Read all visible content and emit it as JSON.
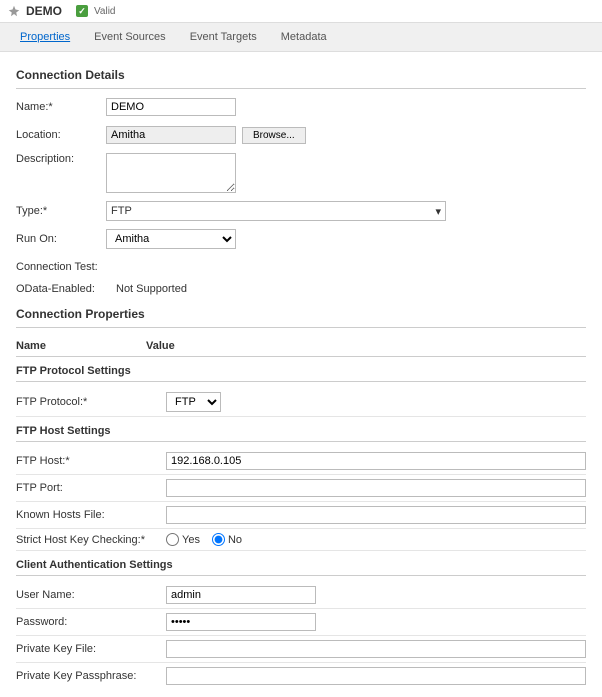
{
  "header": {
    "title": "DEMO",
    "status": "Valid"
  },
  "tabs": {
    "properties": "Properties",
    "eventSources": "Event Sources",
    "eventTargets": "Event Targets",
    "metadata": "Metadata"
  },
  "sections": {
    "connectionDetails": "Connection Details",
    "connectionProperties": "Connection Properties"
  },
  "details": {
    "nameLabel": "Name:",
    "nameValue": "DEMO",
    "locationLabel": "Location:",
    "locationValue": "Amitha",
    "browseLabel": "Browse...",
    "descriptionLabel": "Description:",
    "descriptionValue": "",
    "typeLabel": "Type:",
    "typeValue": "FTP",
    "runOnLabel": "Run On:",
    "runOnValue": "Amitha",
    "connectionTestLabel": "Connection Test:",
    "connectionTestValue": "",
    "odataLabel": "OData-Enabled:",
    "odataValue": "Not Supported"
  },
  "propHeader": {
    "name": "Name",
    "value": "Value"
  },
  "subsections": {
    "ftpProtocol": "FTP Protocol Settings",
    "ftpHost": "FTP Host Settings",
    "clientAuth": "Client Authentication Settings"
  },
  "props": {
    "ftpProtocolLabel": "FTP Protocol:",
    "ftpProtocolValue": "FTP",
    "ftpHostLabel": "FTP Host:",
    "ftpHostValue": "192.168.0.105",
    "ftpPortLabel": "FTP Port:",
    "ftpPortValue": "",
    "knownHostsLabel": "Known Hosts File:",
    "knownHostsValue": "",
    "strictLabel": "Strict Host Key Checking:",
    "yesLabel": "Yes",
    "noLabel": "No",
    "userNameLabel": "User Name:",
    "userNameValue": "admin",
    "passwordLabel": "Password:",
    "passwordValue": "•••••",
    "privateKeyLabel": "Private Key File:",
    "privateKeyValue": "",
    "passphraseLabel": "Private Key Passphrase:",
    "passphraseValue": ""
  }
}
